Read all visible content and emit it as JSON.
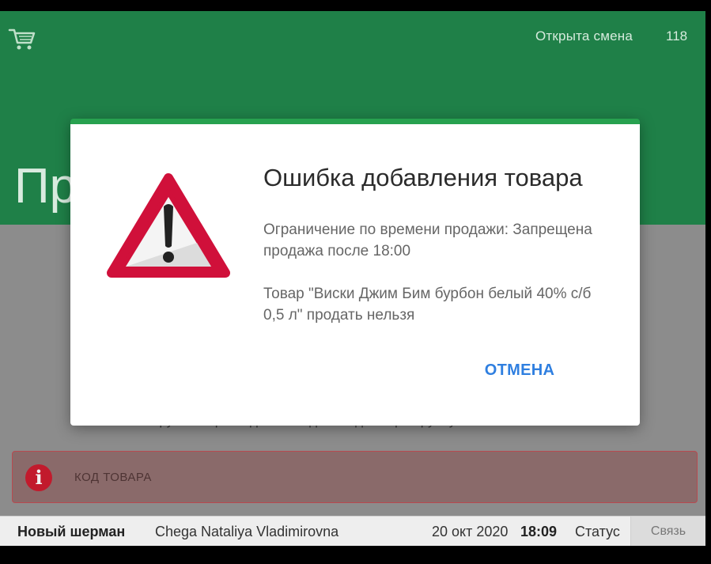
{
  "header": {
    "shift_label": "Открыта смена",
    "shift_number": "118",
    "title_partial": "Пр"
  },
  "main": {
    "hint_partial": "отсканируйте штрихкод или введите код товара вручную"
  },
  "code_input": {
    "placeholder": "КОД ТОВАРА",
    "icon_glyph": "i"
  },
  "statusbar": {
    "store": "Новый шерман",
    "cashier": "Chega Nataliya Vladimirovna",
    "date": "20 окт 2020",
    "time": "18:09",
    "status_label": "Статус",
    "connection_label": "Связь"
  },
  "dialog": {
    "title": "Ошибка добавления товара",
    "message_line1": "Ограничение по времени продажи: Запрещена продажа после 18:00",
    "message_line2": "Товар \"Виски Джим Бим бурбон белый 40% с/б 0,5 л\" продать нельзя",
    "cancel_label": "ОТМЕНА"
  },
  "colors": {
    "header_green": "#1f8048",
    "dialog_accent": "#27a14f",
    "warning_red": "#d0103a",
    "button_blue": "#2f7fe0"
  },
  "icons": {
    "cart": "shopping-cart-icon",
    "warning": "warning-triangle-icon",
    "info": "info-circle-icon"
  }
}
